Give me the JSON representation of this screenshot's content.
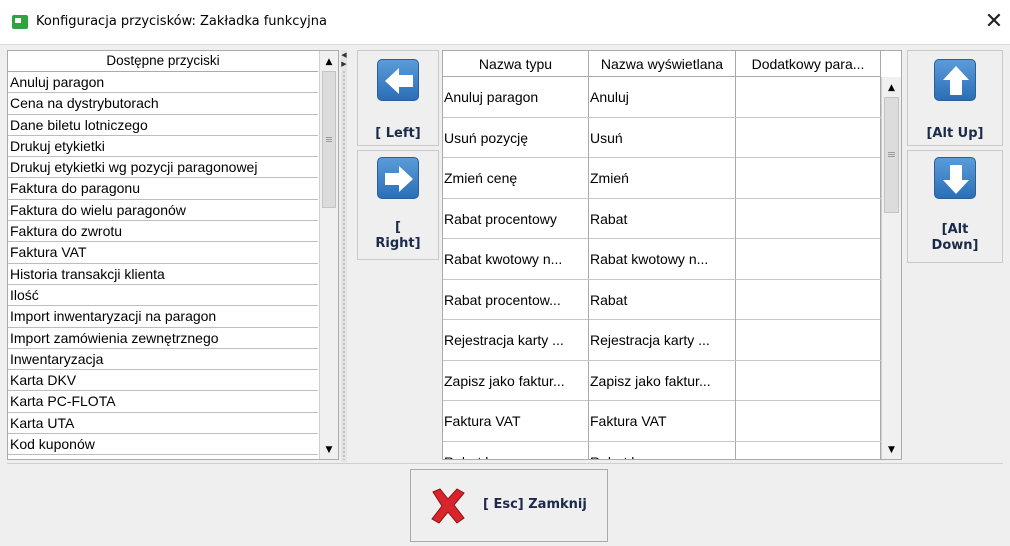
{
  "window": {
    "title": "Konfiguracja przycisków:  Zakładka funkcyjna",
    "close_glyph": "✕"
  },
  "left_list": {
    "header": "Dostępne przyciski",
    "items": [
      "Anuluj paragon",
      "Cena na dystrybutorach",
      "Dane biletu lotniczego",
      "Drukuj etykietki",
      "Drukuj etykietki wg pozycji paragonowej",
      "Faktura do paragonu",
      "Faktura do wielu paragonów",
      "Faktura do zwrotu",
      "Faktura VAT",
      "Historia transakcji klienta",
      "Ilość",
      "Import inwentaryzacji na paragon",
      "Import zamówienia zewnętrznego",
      "Inwentaryzacja",
      "Karta DKV",
      "Karta PC-FLOTA",
      "Karta UTA",
      "Kod kuponów"
    ]
  },
  "buttons": {
    "left_label": "[ Left]",
    "right_label_line1": "[",
    "right_label_line2": "Right]",
    "up_label": "[Alt Up]",
    "down_label_line1": "[Alt",
    "down_label_line2": "Down]",
    "close_label": "[ Esc] Zamknij"
  },
  "table": {
    "columns": [
      "Nazwa typu",
      "Nazwa wyświetlana",
      "Dodatkowy para..."
    ],
    "rows": [
      [
        "Anuluj paragon",
        "Anuluj",
        ""
      ],
      [
        "Usuń pozycję",
        "Usuń",
        ""
      ],
      [
        "Zmień cenę",
        "Zmień",
        ""
      ],
      [
        "Rabat procentowy",
        "Rabat",
        ""
      ],
      [
        "Rabat kwotowy n...",
        "Rabat kwotowy n...",
        ""
      ],
      [
        "Rabat procentow...",
        "Rabat",
        ""
      ],
      [
        "Rejestracja karty ...",
        "Rejestracja karty ...",
        ""
      ],
      [
        "Zapisz jako faktur...",
        "Zapisz jako faktur...",
        ""
      ],
      [
        "Faktura VAT",
        "Faktura VAT",
        ""
      ],
      [
        "Rabat kuponowy",
        "Rabat kuponowy",
        ""
      ]
    ]
  },
  "icons": {
    "app": "app-icon",
    "left": "arrow-left-icon",
    "right": "arrow-right-icon",
    "up": "arrow-up-icon",
    "down": "arrow-down-icon",
    "close": "red-x-icon"
  },
  "colors": {
    "arrow_button_blue": "#3a7cc4",
    "close_x_red": "#d9242b",
    "app_icon_green": "#2fa43e"
  }
}
